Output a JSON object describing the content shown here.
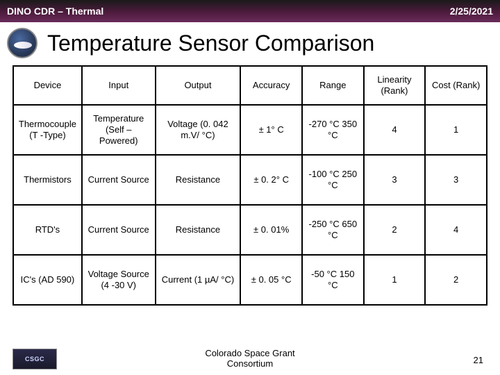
{
  "header": {
    "left": "DINO CDR – Thermal",
    "right": "2/25/2021"
  },
  "title": "Temperature Sensor Comparison",
  "table": {
    "headers": [
      "Device",
      "Input",
      "Output",
      "Accuracy",
      "Range",
      "Linearity (Rank)",
      "Cost (Rank)"
    ],
    "rows": [
      {
        "device": "Thermocouple (T -Type)",
        "input": "Temperature (Self – Powered)",
        "output": "Voltage (0. 042 m.V/ °C)",
        "accuracy": "± 1° C",
        "range": "-270 °C 350 °C",
        "linearity": "4",
        "cost": "1"
      },
      {
        "device": "Thermistors",
        "input": "Current Source",
        "output": "Resistance",
        "accuracy": "± 0. 2° C",
        "range": "-100 °C 250 °C",
        "linearity": "3",
        "cost": "3"
      },
      {
        "device": "RTD's",
        "input": "Current Source",
        "output": "Resistance",
        "accuracy": "± 0. 01%",
        "range": "-250 °C 650 °C",
        "linearity": "2",
        "cost": "4"
      },
      {
        "device": "IC's (AD 590)",
        "input": "Voltage Source (4 -30 V)",
        "output": "Current (1 µA/ °C)",
        "accuracy": "± 0. 05 °C",
        "range": "-50 °C 150 °C",
        "linearity": "1",
        "cost": "2"
      }
    ]
  },
  "footer": {
    "org_line1": "Colorado Space Grant",
    "org_line2": "Consortium",
    "logo_text": "CSGC",
    "page": "21"
  }
}
